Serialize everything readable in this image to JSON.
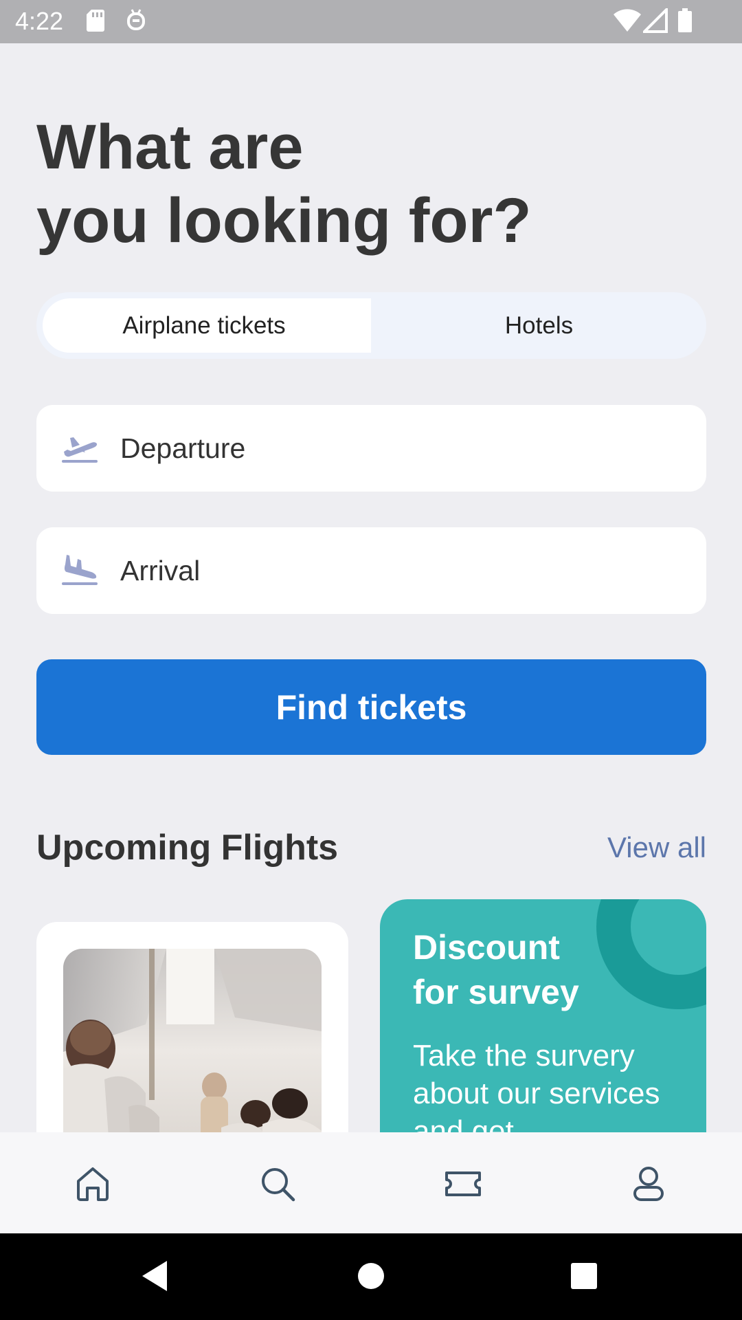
{
  "status_bar": {
    "time": "4:22"
  },
  "headline": {
    "line1": "What are",
    "line2": "you looking for?"
  },
  "tabs": {
    "airplane": "Airplane tickets",
    "hotels": "Hotels"
  },
  "fields": {
    "departure_placeholder": "Departure",
    "arrival_placeholder": "Arrival"
  },
  "find_button": "Find tickets",
  "upcoming": {
    "title": "Upcoming Flights",
    "view_all": "View all"
  },
  "promo": {
    "title_line1": "Discount",
    "title_line2": "for survey",
    "body": "Take the survery about our services and get"
  },
  "nav": {
    "items": [
      {
        "icon": "home-icon"
      },
      {
        "icon": "search-icon"
      },
      {
        "icon": "ticket-icon"
      },
      {
        "icon": "profile-icon"
      }
    ]
  },
  "colors": {
    "background": "#eeeef2",
    "primary": "#1b74d5",
    "promo": "#3bb8b5",
    "link": "#5c76ab",
    "icon": "#9aa3cc"
  }
}
